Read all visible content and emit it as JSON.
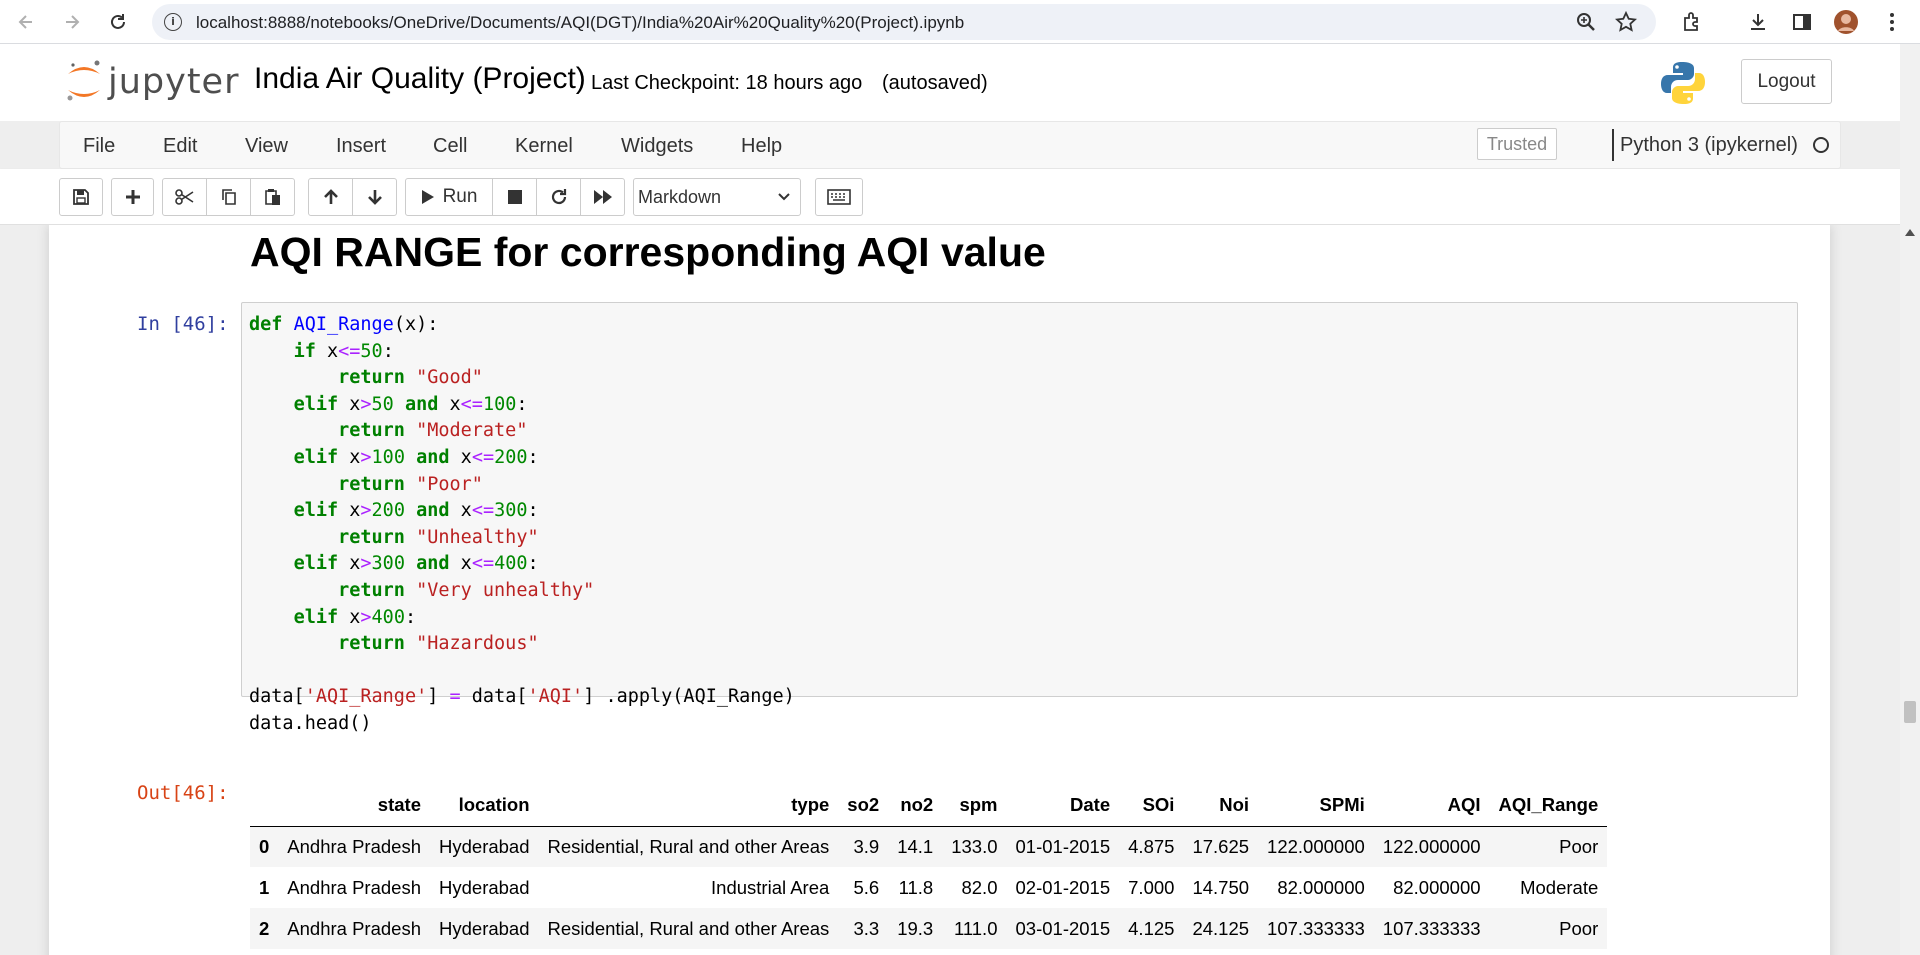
{
  "browser": {
    "url": "localhost:8888/notebooks/OneDrive/Documents/AQI(DGT)/India%20Air%20Quality%20(Project).ipynb"
  },
  "header": {
    "logo_text": "jupyter",
    "notebook_title": "India Air Quality (Project)",
    "checkpoint": "Last Checkpoint: 18 hours ago",
    "autosave": "(autosaved)",
    "logout_label": "Logout"
  },
  "menubar": {
    "items": [
      "File",
      "Edit",
      "View",
      "Insert",
      "Cell",
      "Kernel",
      "Widgets",
      "Help"
    ],
    "trusted_label": "Trusted",
    "kernel_name": "Python 3 (ipykernel)"
  },
  "toolbar": {
    "run_label": "Run",
    "cell_type": "Markdown"
  },
  "notebook": {
    "heading": "AQI RANGE for corresponding AQI value",
    "in_prompt": "In [46]:",
    "out_prompt": "Out[46]:",
    "code_lines": [
      "def AQI_Range(x):",
      "    if x<=50:",
      "        return \"Good\"",
      "    elif x>50 and x<=100:",
      "        return \"Moderate\"",
      "    elif x>100 and x<=200:",
      "        return \"Poor\"",
      "    elif x>200 and x<=300:",
      "        return \"Unhealthy\"",
      "    elif x>300 and x<=400:",
      "        return \"Very unhealthy\"",
      "    elif x>400:",
      "        return \"Hazardous\"",
      "",
      "data['AQI_Range'] = data['AQI'] .apply(AQI_Range)",
      "data.head()"
    ],
    "table": {
      "columns": [
        "",
        "state",
        "location",
        "type",
        "so2",
        "no2",
        "spm",
        "Date",
        "SOi",
        "Noi",
        "SPMi",
        "AQI",
        "AQI_Range"
      ],
      "rows": [
        [
          "0",
          "Andhra Pradesh",
          "Hyderabad",
          "Residential, Rural and other Areas",
          "3.9",
          "14.1",
          "133.0",
          "01-01-2015",
          "4.875",
          "17.625",
          "122.000000",
          "122.000000",
          "Poor"
        ],
        [
          "1",
          "Andhra Pradesh",
          "Hyderabad",
          "Industrial Area",
          "5.6",
          "11.8",
          "82.0",
          "02-01-2015",
          "7.000",
          "14.750",
          "82.000000",
          "82.000000",
          "Moderate"
        ],
        [
          "2",
          "Andhra Pradesh",
          "Hyderabad",
          "Residential, Rural and other Areas",
          "3.3",
          "19.3",
          "111.0",
          "03-01-2015",
          "4.125",
          "24.125",
          "107.333333",
          "107.333333",
          "Poor"
        ]
      ]
    }
  }
}
